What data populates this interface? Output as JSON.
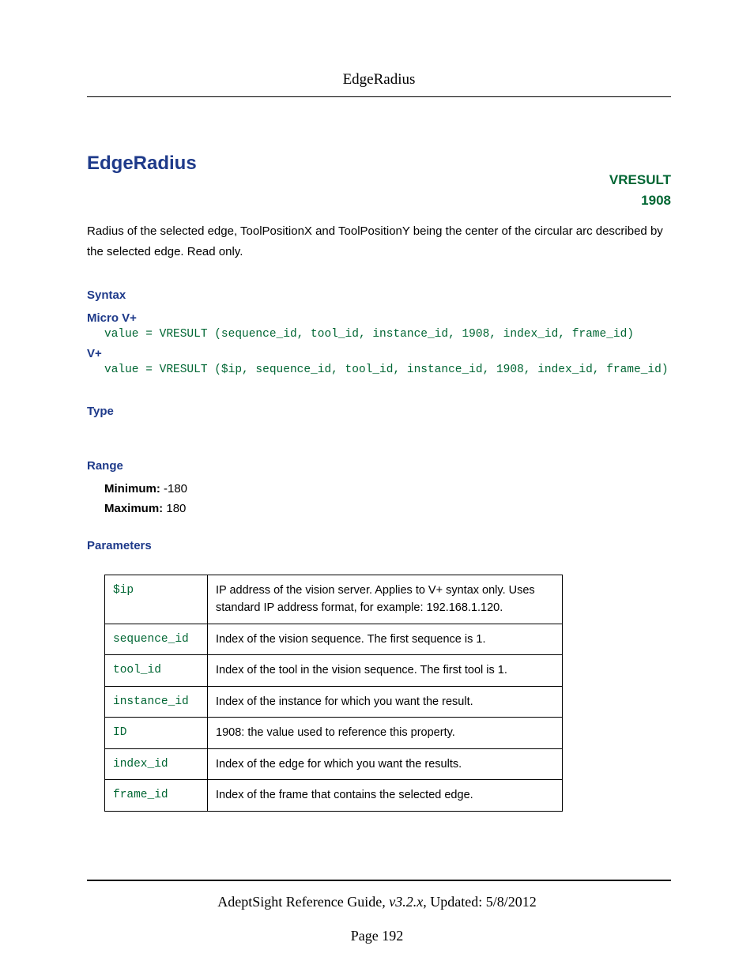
{
  "header": {
    "title": "EdgeRadius"
  },
  "title": "EdgeRadius",
  "vresult": {
    "label": "VRESULT",
    "code": "1908"
  },
  "description": "Radius of the selected edge, ToolPositionX and ToolPositionY being the center of the circular arc described by the selected edge. Read only.",
  "syntax": {
    "heading": "Syntax",
    "micro_label": "Micro V+",
    "micro_code": "value = VRESULT (sequence_id, tool_id, instance_id, 1908, index_id, frame_id)",
    "vplus_label": "V+",
    "vplus_code": "value = VRESULT ($ip, sequence_id, tool_id, instance_id, 1908, index_id, frame_id)"
  },
  "type": {
    "heading": "Type"
  },
  "range": {
    "heading": "Range",
    "min_label": "Minimum:",
    "min_value": " -180",
    "max_label": "Maximum:",
    "max_value": " 180"
  },
  "parameters": {
    "heading": "Parameters",
    "rows": [
      {
        "name": "$ip",
        "desc": "IP address of the vision server. Applies to V+ syntax only. Uses standard IP address format, for example: 192.168.1.120."
      },
      {
        "name": "sequence_id",
        "desc": "Index of the vision sequence. The first sequence is 1."
      },
      {
        "name": "tool_id",
        "desc": "Index of the tool in the vision sequence. The first tool is 1."
      },
      {
        "name": "instance_id",
        "desc": "Index of the instance for which you want the result."
      },
      {
        "name": "ID",
        "desc": "1908: the value used to reference this property."
      },
      {
        "name": "index_id",
        "desc": "Index of the edge for which you want the results."
      },
      {
        "name": "frame_id",
        "desc": "Index of the frame that contains the selected edge."
      }
    ]
  },
  "footer": {
    "guide": "AdeptSight Reference Guide",
    "version": ", v3.2.x",
    "updated": ", Updated: 5/8/2012",
    "page_label": "Page 192"
  }
}
